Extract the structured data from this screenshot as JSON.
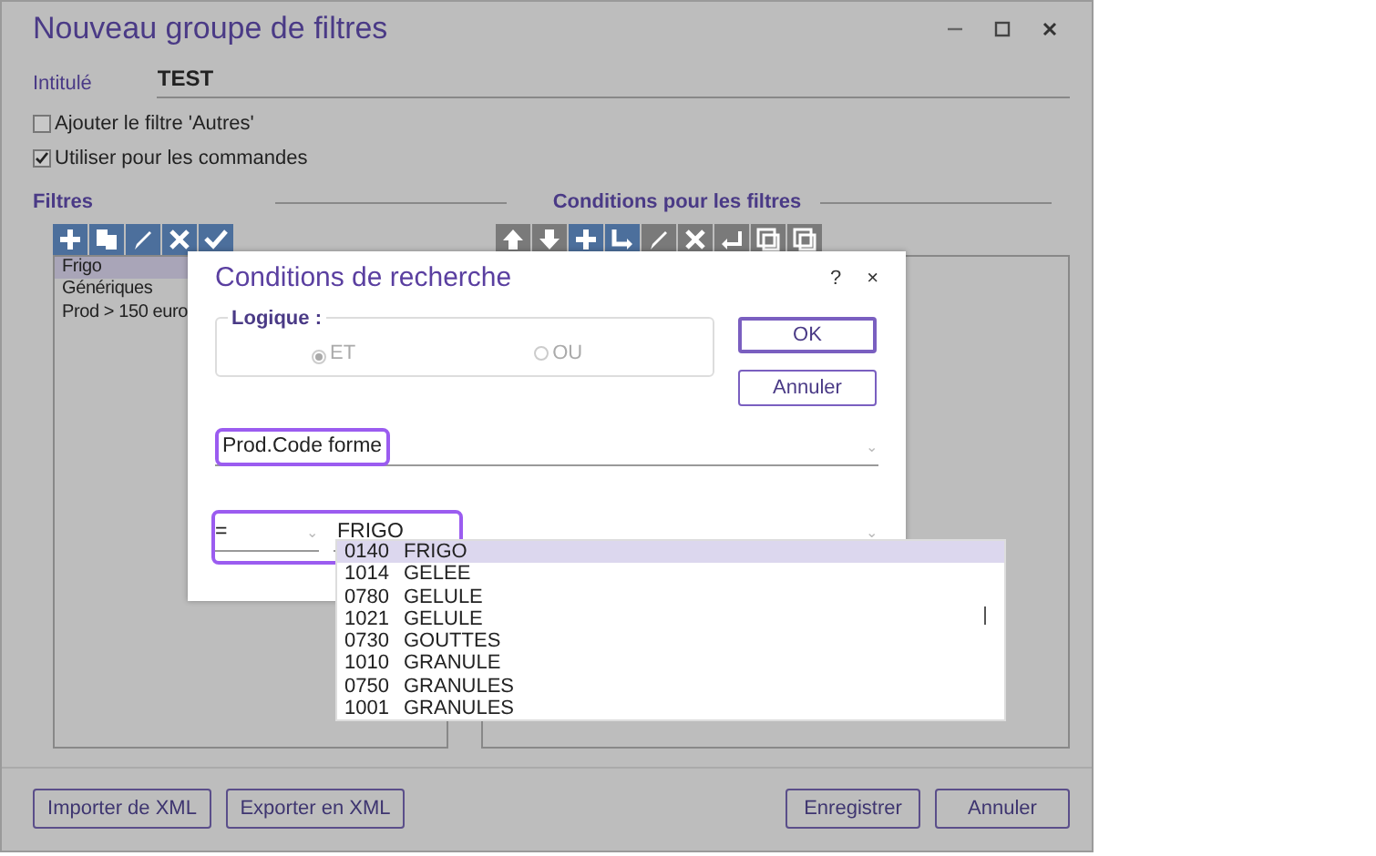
{
  "window": {
    "title": "Nouveau groupe de filtres",
    "controls": [
      {
        "kind": "minimize"
      },
      {
        "kind": "maximize"
      },
      {
        "kind": "close"
      }
    ]
  },
  "intitule": {
    "label": "Intitulé",
    "value": "TEST"
  },
  "checkboxes": [
    {
      "label": "Ajouter le filtre 'Autres'",
      "checked": false
    },
    {
      "label": "Utiliser pour les commandes",
      "checked": true
    }
  ],
  "filters": {
    "heading": "Filtres",
    "toolbar": [
      {
        "kind": "plus",
        "disabled": false
      },
      {
        "kind": "copy",
        "disabled": false
      },
      {
        "kind": "pencil",
        "disabled": false
      },
      {
        "kind": "cross",
        "disabled": false
      },
      {
        "kind": "check",
        "disabled": false
      }
    ],
    "items": [
      {
        "label": "Frigo",
        "selected": true
      },
      {
        "label": "Génériques",
        "selected": false
      },
      {
        "label": "Prod > 150 euro",
        "selected": false
      }
    ]
  },
  "conditions": {
    "heading": "Conditions pour les filtres",
    "toolbar": [
      {
        "kind": "up",
        "disabled": true
      },
      {
        "kind": "down",
        "disabled": true
      },
      {
        "kind": "plus",
        "disabled": false
      },
      {
        "kind": "indent",
        "disabled": false
      },
      {
        "kind": "pencil",
        "disabled": true
      },
      {
        "kind": "cross",
        "disabled": true
      },
      {
        "kind": "return",
        "disabled": true
      },
      {
        "kind": "stack",
        "disabled": true
      },
      {
        "kind": "stack",
        "disabled": true
      }
    ]
  },
  "footer_buttons": {
    "left": [
      "Importer de XML",
      "Exporter en XML"
    ],
    "right": [
      "Enregistrer",
      "Annuler"
    ]
  },
  "dialog": {
    "title": "Conditions de recherche",
    "help": "?",
    "close": "×",
    "logic": {
      "legend": "Logique :",
      "options": [
        {
          "label": "ET",
          "selected": true
        },
        {
          "label": "OU",
          "selected": false
        }
      ]
    },
    "buttons": [
      {
        "label": "OK",
        "default": true
      },
      {
        "label": "Annuler",
        "default": false
      }
    ],
    "field": {
      "value": "Prod.Code forme",
      "highlighted": true,
      "caret": "⌄"
    },
    "operator": {
      "value": "=",
      "highlighted": true,
      "caret": "⌄"
    },
    "criterion": {
      "value": "FRIGO",
      "highlighted": true,
      "caret": "⌄"
    },
    "dropdown": [
      {
        "code": "0140",
        "label": "FRIGO",
        "selected": true
      },
      {
        "code": "1014",
        "label": "GELEE",
        "selected": false
      },
      {
        "code": "0780",
        "label": "GELULE",
        "selected": false
      },
      {
        "code": "1021",
        "label": "GELULE",
        "selected": false
      },
      {
        "code": "0730",
        "label": "GOUTTES",
        "selected": false
      },
      {
        "code": "1010",
        "label": "GRANULE",
        "selected": false
      },
      {
        "code": "0750",
        "label": "GRANULES",
        "selected": false
      },
      {
        "code": "1001",
        "label": "GRANULES",
        "selected": false
      }
    ]
  }
}
